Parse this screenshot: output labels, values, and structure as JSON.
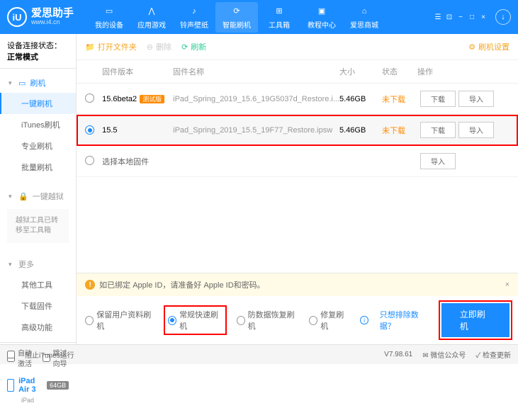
{
  "app": {
    "name": "爱思助手",
    "url": "www.i4.cn",
    "logo_letter": "iU"
  },
  "nav": {
    "items": [
      {
        "label": "我的设备"
      },
      {
        "label": "应用游戏"
      },
      {
        "label": "铃声壁纸"
      },
      {
        "label": "智能刷机"
      },
      {
        "label": "工具箱"
      },
      {
        "label": "教程中心"
      },
      {
        "label": "爱思商城"
      }
    ]
  },
  "sidebar": {
    "conn_label": "设备连接状态：",
    "conn_value": "正常模式",
    "flash_head": "刷机",
    "flash_items": [
      "一键刷机",
      "iTunes刷机",
      "专业刷机",
      "批量刷机"
    ],
    "jb_head": "一键越狱",
    "jb_note": "越狱工具已转移至工具箱",
    "more_head": "更多",
    "more_items": [
      "其他工具",
      "下载固件",
      "高级功能"
    ],
    "auto_activate": "自动激活",
    "skip_guide": "跳过向导",
    "device_name": "iPad Air 3",
    "device_storage": "64GB",
    "device_sub": "iPad"
  },
  "toolbar": {
    "open_folder": "打开文件夹",
    "delete": "删除",
    "refresh": "刷新",
    "settings": "刷机设置"
  },
  "table": {
    "headers": {
      "version": "固件版本",
      "name": "固件名称",
      "size": "大小",
      "status": "状态",
      "ops": "操作"
    },
    "rows": [
      {
        "version": "15.6beta2",
        "beta": "测试版",
        "name": "iPad_Spring_2019_15.6_19G5037d_Restore.i...",
        "size": "5.46GB",
        "status": "未下载",
        "dl": "下载",
        "imp": "导入",
        "selected": false
      },
      {
        "version": "15.5",
        "beta": "",
        "name": "iPad_Spring_2019_15.5_19F77_Restore.ipsw",
        "size": "5.46GB",
        "status": "未下载",
        "dl": "下载",
        "imp": "导入",
        "selected": true
      }
    ],
    "local_label": "选择本地固件",
    "local_btn": "导入"
  },
  "warn": {
    "text": "如已绑定 Apple ID，请准备好 Apple ID和密码。"
  },
  "options": {
    "keep_data": "保留用户资料刷机",
    "normal": "常规快速刷机",
    "anti": "防数据恢复刷机",
    "repair": "修复刷机",
    "exclude": "只想排除数据？",
    "go": "立即刷机"
  },
  "status": {
    "block_itunes": "阻止iTunes运行",
    "version": "V7.98.61",
    "wechat": "微信公众号",
    "update": "检查更新"
  }
}
